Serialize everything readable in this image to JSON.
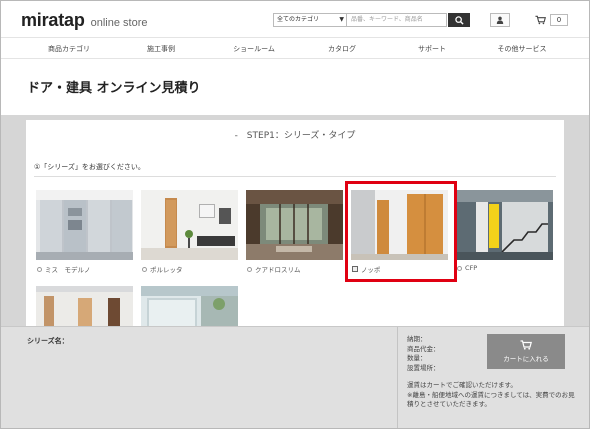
{
  "header": {
    "logo": "miratap",
    "logo_sub": "online store",
    "category_select": "全てのカテゴリ",
    "search_placeholder": "品番、キーワード、商品名",
    "cart_count": "0"
  },
  "nav": {
    "items": [
      "商品カテゴリ",
      "施工事例",
      "ショールーム",
      "カタログ",
      "サポート",
      "その他サービス"
    ]
  },
  "page": {
    "title": "ドア・建具 オンライン見積り"
  },
  "step": {
    "title": "-　STEP1：シリーズ・タイプ",
    "instruction": "①「シリーズ」をお選びください。"
  },
  "series": {
    "items": [
      {
        "label": "ミス　モデルノ",
        "selected": false
      },
      {
        "label": "ポルレッタ",
        "selected": false
      },
      {
        "label": "クアドロスリム",
        "selected": false
      },
      {
        "label": "ノッポ",
        "selected": true
      },
      {
        "label": "CFP",
        "selected": false
      },
      {
        "label": "",
        "selected": false
      },
      {
        "label": "",
        "selected": false
      }
    ]
  },
  "summary": {
    "series_label": "シリーズ名：",
    "delivery_label": "納期：",
    "product_code_label": "商品代金：",
    "quantity_label": "数量：",
    "install_label": "設置場所：",
    "cart_button": "カートに入れる",
    "note_1": "運賃はカートでご確認いただけます。",
    "note_2": "※離島・船便地域への運賃につきましては、実費でのお見積りとさせていただきます。"
  },
  "colors": {
    "highlight": "#e00012",
    "cart_button": "#8a8a8a"
  }
}
